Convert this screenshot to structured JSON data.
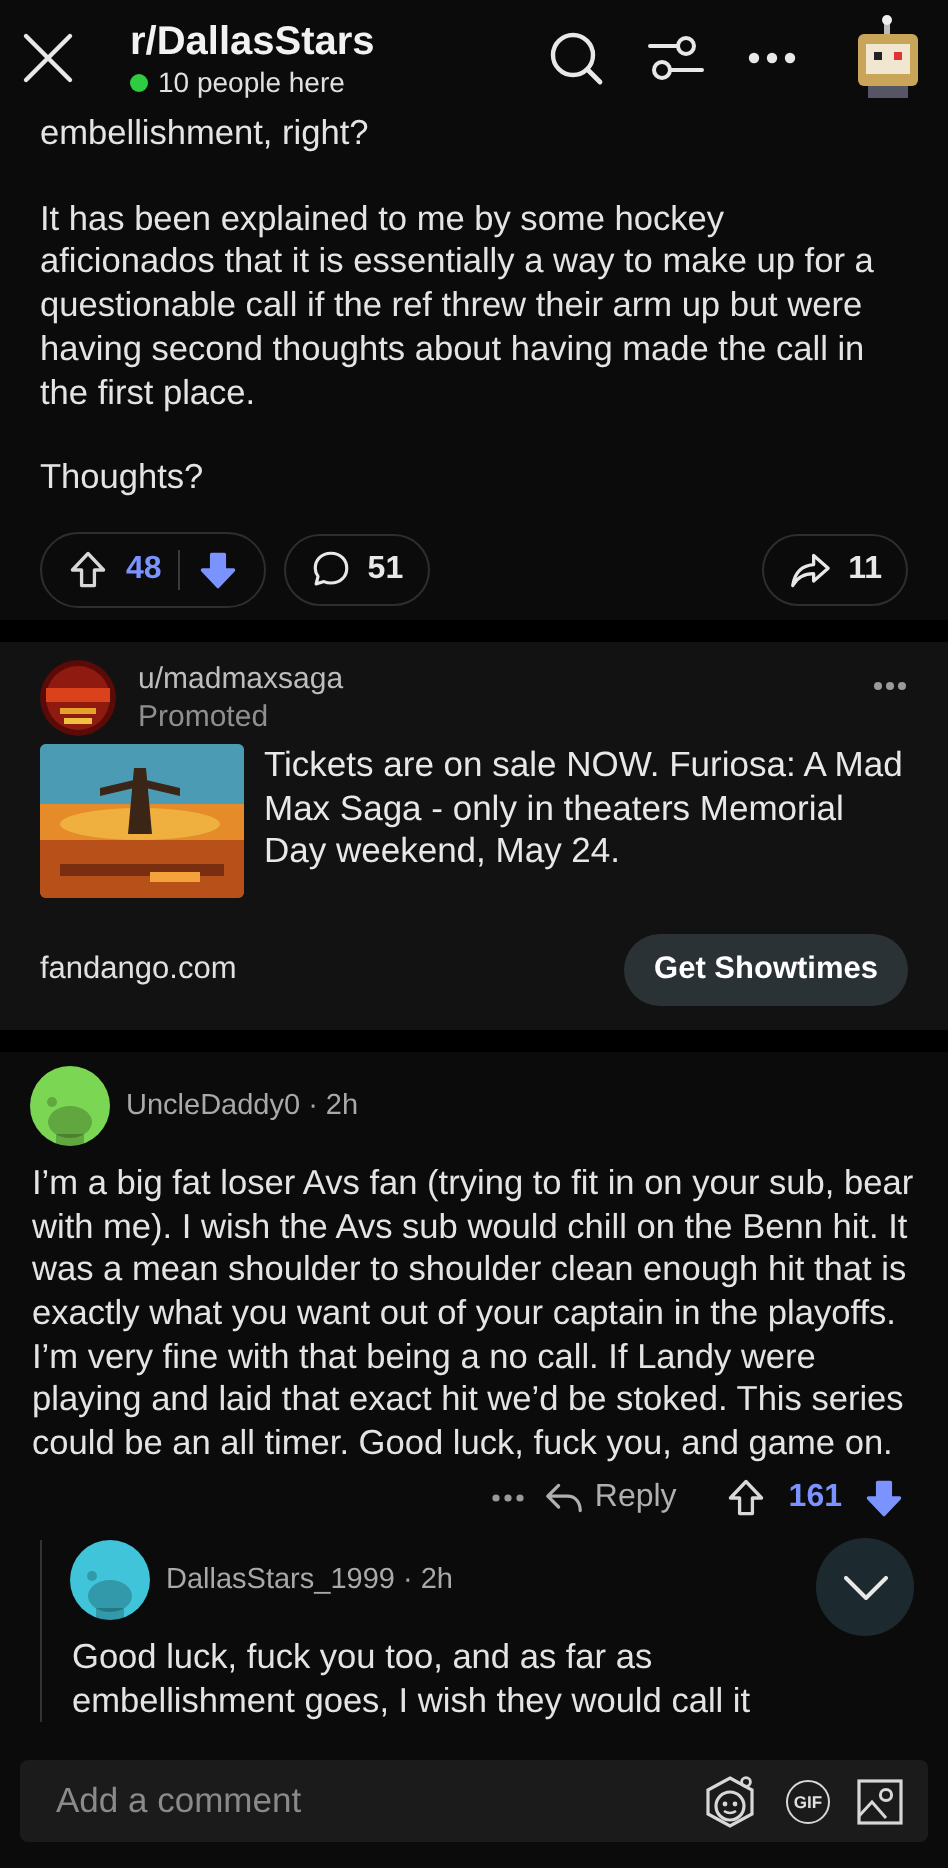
{
  "header": {
    "title": "r/DallasStars",
    "online": "10 people here"
  },
  "post": {
    "paragraphs": [
      "embellishment, right?",
      "It has been explained to me by some hockey aficionados that it is essentially a way to make up for a questionable call if the ref threw their arm up but were having second thoughts about having made the call in the first place.",
      "Thoughts?"
    ],
    "upvoted": false,
    "downvoted": true,
    "score": "48",
    "comments": "51",
    "shares": "11"
  },
  "ad": {
    "user": "u/madmaxsaga",
    "label": "Promoted",
    "text": "Tickets are on sale NOW. Furiosa: A Mad Max Saga - only in theaters Memorial Day weekend, May 24.",
    "domain": "fandango.com",
    "button": "Get Showtimes"
  },
  "comments": [
    {
      "byline": "UncleDaddy0 · 2h",
      "color": "#7bd653",
      "body": "I’m a big fat loser Avs fan (trying to fit in on your sub, bear with me). I wish the Avs sub would chill on the Benn hit. It was a mean shoulder to shoulder clean enough hit that is exactly what you want out of your captain in the playoffs. I’m very fine with that being a no call. If Landy were playing and laid that exact hit we’d be stoked. This series could be an all timer. Good luck, fuck you, and game on.",
      "reply_label": "Reply",
      "upvoted": false,
      "downvoted": true,
      "score": "161",
      "children": [
        {
          "byline": "DallasStars_1999 · 2h",
          "color": "#3fc4d9",
          "body": "Good luck, fuck you too, and as far as embellishment goes, I wish they would call it"
        }
      ]
    }
  ],
  "composer": {
    "placeholder": "Add a comment",
    "gif_label": "GIF"
  }
}
